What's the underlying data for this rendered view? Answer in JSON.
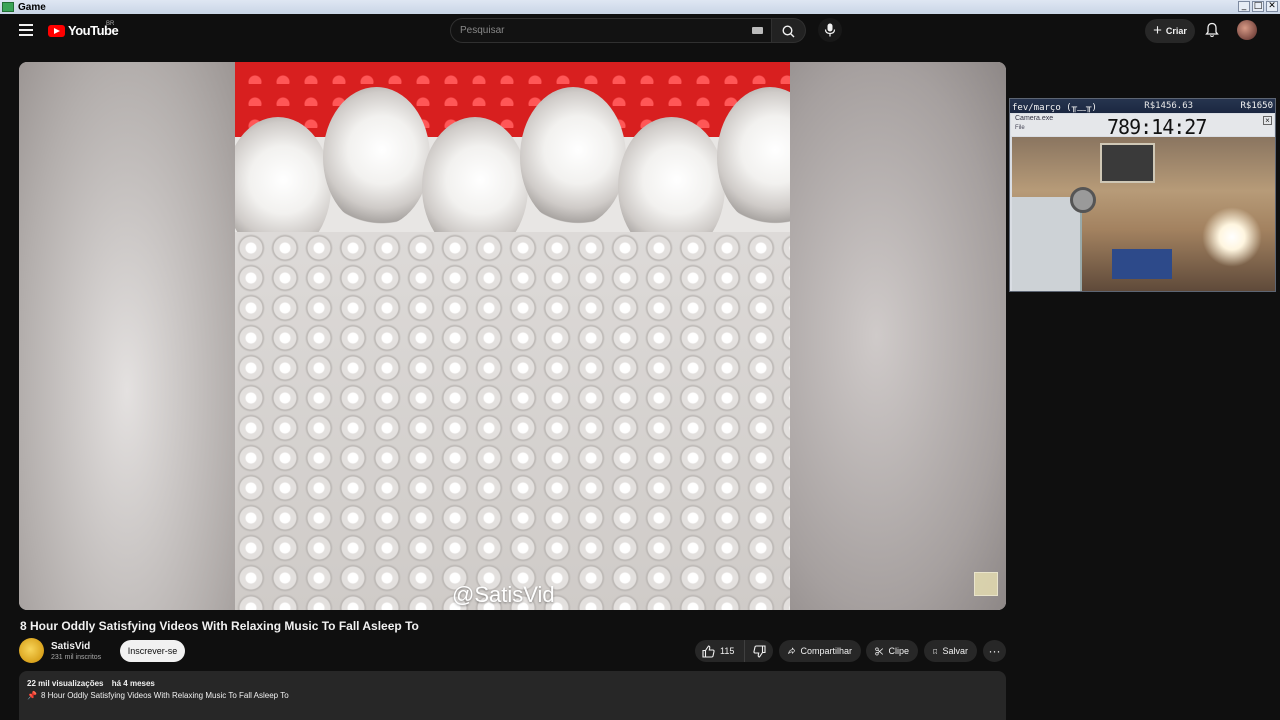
{
  "window": {
    "title": "Game",
    "controls": [
      "_",
      "□",
      "✕"
    ]
  },
  "header": {
    "logo_text": "YouTube",
    "country_code": "BR",
    "search_placeholder": "Pesquisar",
    "create_label": "Criar"
  },
  "player": {
    "watermark": "@SatisVid"
  },
  "overlay": {
    "goal_label": "fev/março (╥﹏╥)",
    "goal_current": "R$1456.63",
    "goal_target": "R$1650",
    "camera_label": "Camera.exe",
    "file_menu": "File",
    "timer": "789:14:27"
  },
  "video": {
    "title": "8 Hour Oddly Satisfying Videos With Relaxing Music To Fall Asleep To",
    "channel_name": "SatisVid",
    "subscribers": "231 mil inscritos",
    "subscribe_label": "Inscrever-se",
    "likes": "115",
    "share_label": "Compartilhar",
    "clip_label": "Clipe",
    "save_label": "Salvar",
    "more_label": "···"
  },
  "description": {
    "views": "22 mil visualizações",
    "date": "há 4 meses",
    "first_line": "8 Hour Oddly Satisfying Videos With Relaxing Music To Fall Asleep To"
  },
  "colors": {
    "background": "#0f0f0f",
    "brand_red": "#ff0000",
    "button_bg": "#272727",
    "subscribe_bg": "#f1f1f1"
  }
}
